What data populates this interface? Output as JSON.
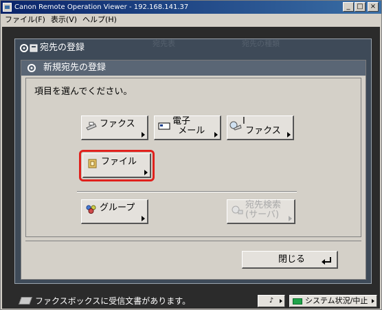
{
  "window": {
    "title": "Canon Remote Operation Viewer - 192.168.141.37",
    "controls": [
      "_",
      "□",
      "×"
    ]
  },
  "menu": [
    "ファイル(F)",
    "表示(V)",
    "ヘルプ(H)"
  ],
  "panel": {
    "title": "宛先の登録",
    "ghost_headers": [
      "宛先表",
      "宛先の種類"
    ]
  },
  "dialog": {
    "title": "新規宛先の登録",
    "prompt": "項目を選んでください。",
    "buttons": {
      "fax": "ファクス",
      "email": "電子\n  メール",
      "ifax": "I\n ファクス",
      "file": "ファイル",
      "group": "グループ",
      "search": "宛先検索\n(サーバ)"
    },
    "highlighted": "ファイル",
    "close": "閉じる"
  },
  "status": {
    "message": "ファクスボックスに受信文書があります。",
    "sound_label": "♪",
    "system_button": "システム状況/中止",
    "led_color": "#1fa34a"
  },
  "colors": {
    "highlight": "#e0201c",
    "titlebar_start": "#0a246a",
    "titlebar_end": "#3a6ea5"
  }
}
